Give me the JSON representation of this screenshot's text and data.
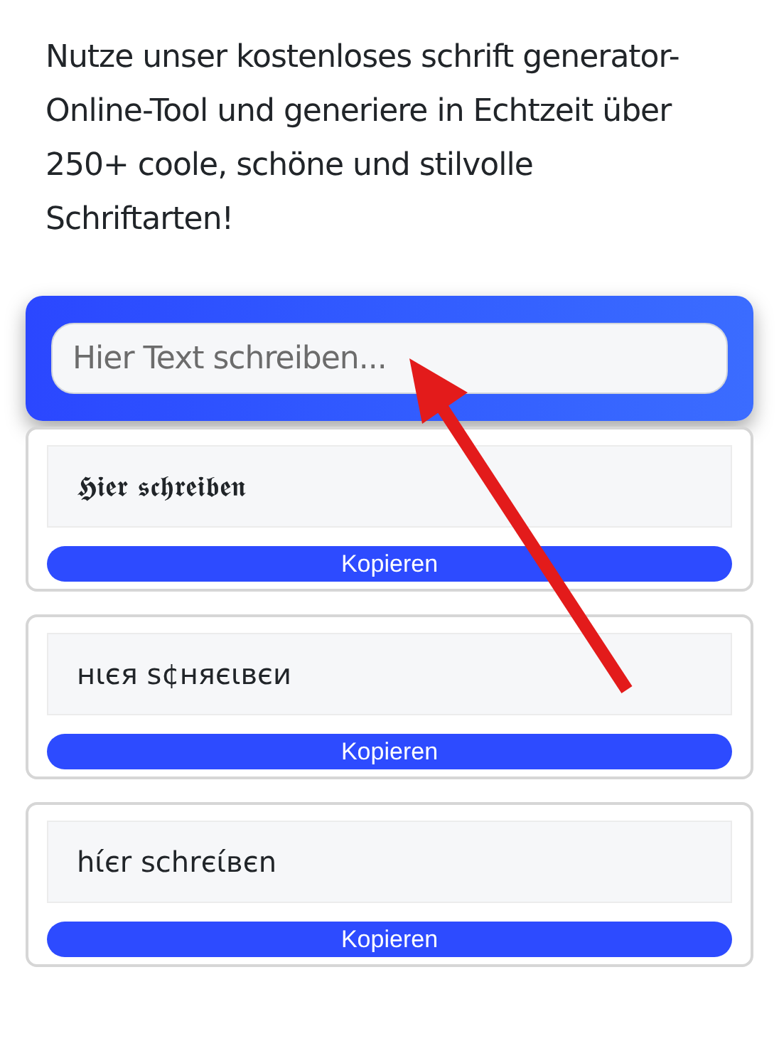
{
  "intro": "Nutze unser kostenloses schrift generator-Online-Tool und generiere in Echtzeit über 250+ coole, schöne und stilvolle Schriftarten!",
  "input": {
    "placeholder": "Hier Text schreiben..."
  },
  "results": [
    {
      "sample": "𝕳𝖎𝖊𝖗 𝖘𝖈𝖍𝖗𝖊𝖎𝖇𝖊𝖓",
      "button": "Kopieren"
    },
    {
      "sample": "нιєя ѕ¢няєιвєи",
      "button": "Kopieren"
    },
    {
      "sample": "hίєr schrєίвєn",
      "button": "Kopieren"
    }
  ]
}
